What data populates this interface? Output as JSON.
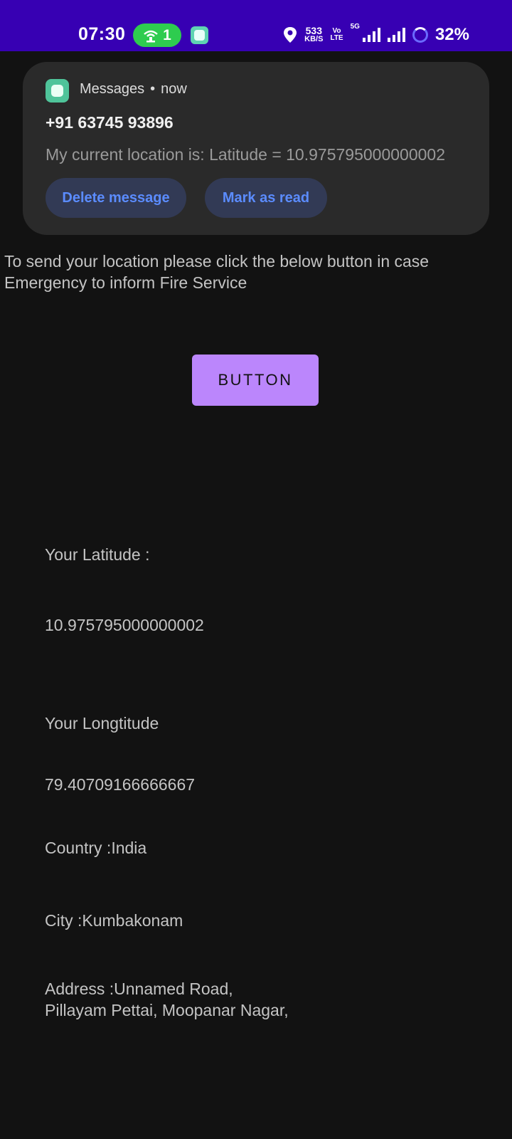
{
  "status_bar": {
    "time": "07:30",
    "hotspot_count": "1",
    "net_speed_value": "533",
    "net_speed_unit": "KB/S",
    "volte_top": "Vo",
    "volte_bottom": "LTE",
    "network_type": "5G",
    "battery": "32%",
    "bg_color": "#3700b3"
  },
  "notification": {
    "app_name": "Messages",
    "separator": "•",
    "time": "now",
    "sender": "+91 63745 93896",
    "body": "My current location is: Latitude = 10.975795000000002",
    "actions": {
      "delete": "Delete message",
      "read": "Mark as read"
    }
  },
  "main": {
    "instruction": "To send your location please click the below button in case Emergency to inform Fire Service",
    "button_label": "BUTTON",
    "latitude_label": "Your Latitude :",
    "latitude_value": "10.975795000000002",
    "longitude_label": "Your Longtitude",
    "longitude_value": "79.40709166666667",
    "country": "Country :India",
    "city": "City :Kumbakonam",
    "address_line1": "Address :Unnamed Road,",
    "address_line2": "Pillayam Pettai, Moopanar Nagar,",
    "accent_color": "#bb86fc"
  }
}
